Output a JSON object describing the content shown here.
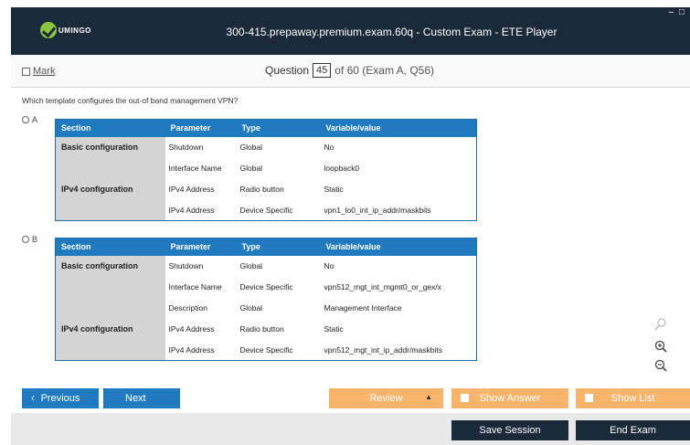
{
  "window": {
    "logo_text": "UMINGO",
    "title": "300-415.prepaway.premium.exam.60q - Custom Exam - ETE Player",
    "min_glyph": "–",
    "max_glyph": "□"
  },
  "header": {
    "mark_label": "Mark",
    "question_label": "Question",
    "question_number": "45",
    "question_of": "of 60 (Exam A, Q56)"
  },
  "question": {
    "text": "Which template configures the out-of band management VPN?"
  },
  "options": [
    {
      "letter": "A",
      "headers": [
        "Section",
        "Parameter",
        "Type",
        "Variable/value"
      ],
      "sections": [
        {
          "name": "Basic configuration"
        },
        {
          "name": "IPv4 configuration"
        }
      ],
      "rows": [
        {
          "parameter": "Shutdown",
          "type": "Global",
          "value": "No"
        },
        {
          "parameter": "Interface Name",
          "type": "Global",
          "value": "loopback0"
        },
        {
          "parameter": "IPv4 Address",
          "type": "Radio button",
          "value": "Static"
        },
        {
          "parameter": "IPv4 Address",
          "type": "Device Specific",
          "value": "vpn1_lo0_int_ip_addr/maskbits"
        }
      ]
    },
    {
      "letter": "B",
      "headers": [
        "Section",
        "Parameter",
        "Type",
        "Variable/value"
      ],
      "sections": [
        {
          "name": "Basic configuration"
        },
        {
          "name": "IPv4 configuration"
        }
      ],
      "rows": [
        {
          "parameter": "Shutdown",
          "type": "Global",
          "value": "No"
        },
        {
          "parameter": "Interface Name",
          "type": "Device Specific",
          "value": "vpn512_mgt_int_mgmt0_or_gex/x"
        },
        {
          "parameter": "Description",
          "type": "Global",
          "value": "Management Interface"
        },
        {
          "parameter": "IPv4 Address",
          "type": "Radio button",
          "value": "Static"
        },
        {
          "parameter": "IPv4 Address",
          "type": "Device Specific",
          "value": "vpn512_mgt_int_ip_addr/maskbits"
        }
      ]
    }
  ],
  "nav": {
    "previous": "Previous",
    "next": "Next",
    "review": "Review",
    "show_answer": "Show Answer",
    "show_list": "Show List",
    "save_session": "Save Session",
    "end_exam": "End Exam",
    "prev_chevron": "‹",
    "review_caret": "▲"
  },
  "colors": {
    "titlebar": "#1b2a38",
    "accent_blue": "#1f7abf",
    "accent_orange": "#f8b56b",
    "section_gray": "#d4d4d4",
    "logo_green": "#8cc63f"
  }
}
